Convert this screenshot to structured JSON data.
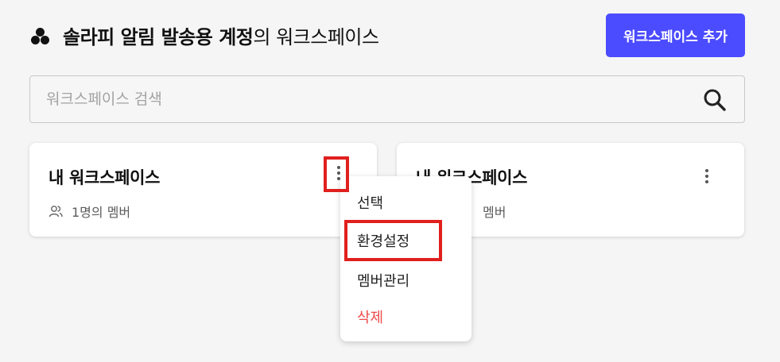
{
  "header": {
    "title_bold": "솔라피 알림 발송용 계정",
    "title_suffix": "의 워크스페이스",
    "add_button_label": "워크스페이스 추가",
    "accent_color": "#4b4bff"
  },
  "search": {
    "placeholder": "워크스페이스 검색",
    "value": ""
  },
  "cards": [
    {
      "title": "내 워크스페이스",
      "members": "1명의 멤버"
    },
    {
      "title": "내 워크스페이스",
      "members": "멤버"
    }
  ],
  "menu": {
    "items": [
      {
        "label": "선택"
      },
      {
        "label": "환경설정"
      },
      {
        "label": "멤버관리"
      },
      {
        "label": "삭제",
        "color": "#f04a4a"
      }
    ]
  }
}
